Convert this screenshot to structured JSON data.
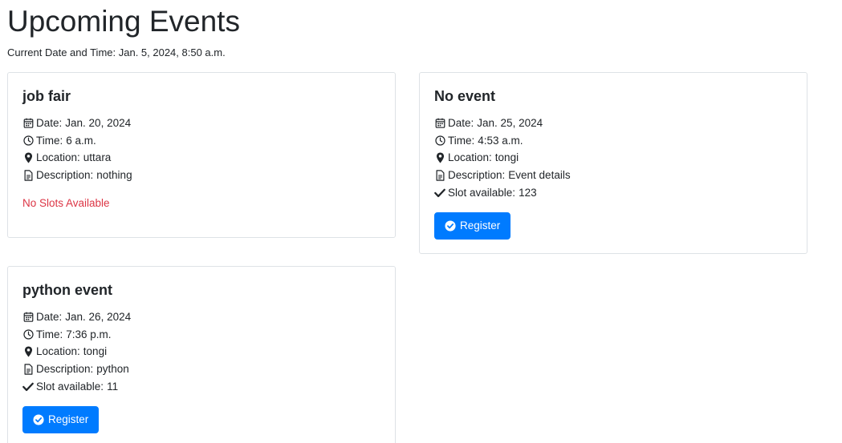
{
  "page": {
    "title": "Upcoming Events",
    "current_datetime": "Current Date and Time: Jan. 5, 2024, 8:50 a.m."
  },
  "labels": {
    "date": "Date:",
    "time": "Time:",
    "location": "Location:",
    "description": "Description:",
    "slot": "Slot available:",
    "no_slots": "No Slots Available",
    "register": "Register"
  },
  "icons": {
    "date": "calendar-icon",
    "time": "clock-icon",
    "location": "map-marker-icon",
    "description": "file-text-icon",
    "slot": "check-icon",
    "register": "check-circle-icon"
  },
  "colors": {
    "primary": "#007bff",
    "danger": "#dc3545",
    "border": "#dee2e6",
    "text": "#212529"
  },
  "events": [
    {
      "title": "job fair",
      "date": "Jan. 20, 2024",
      "time": "6 a.m.",
      "location": "uttara",
      "description": "nothing",
      "slots": null
    },
    {
      "title": "No event",
      "date": "Jan. 25, 2024",
      "time": "4:53 a.m.",
      "location": "tongi",
      "description": "Event details",
      "slots": "123"
    },
    {
      "title": "python event",
      "date": "Jan. 26, 2024",
      "time": "7:36 p.m.",
      "location": "tongi",
      "description": "python",
      "slots": "11"
    }
  ]
}
